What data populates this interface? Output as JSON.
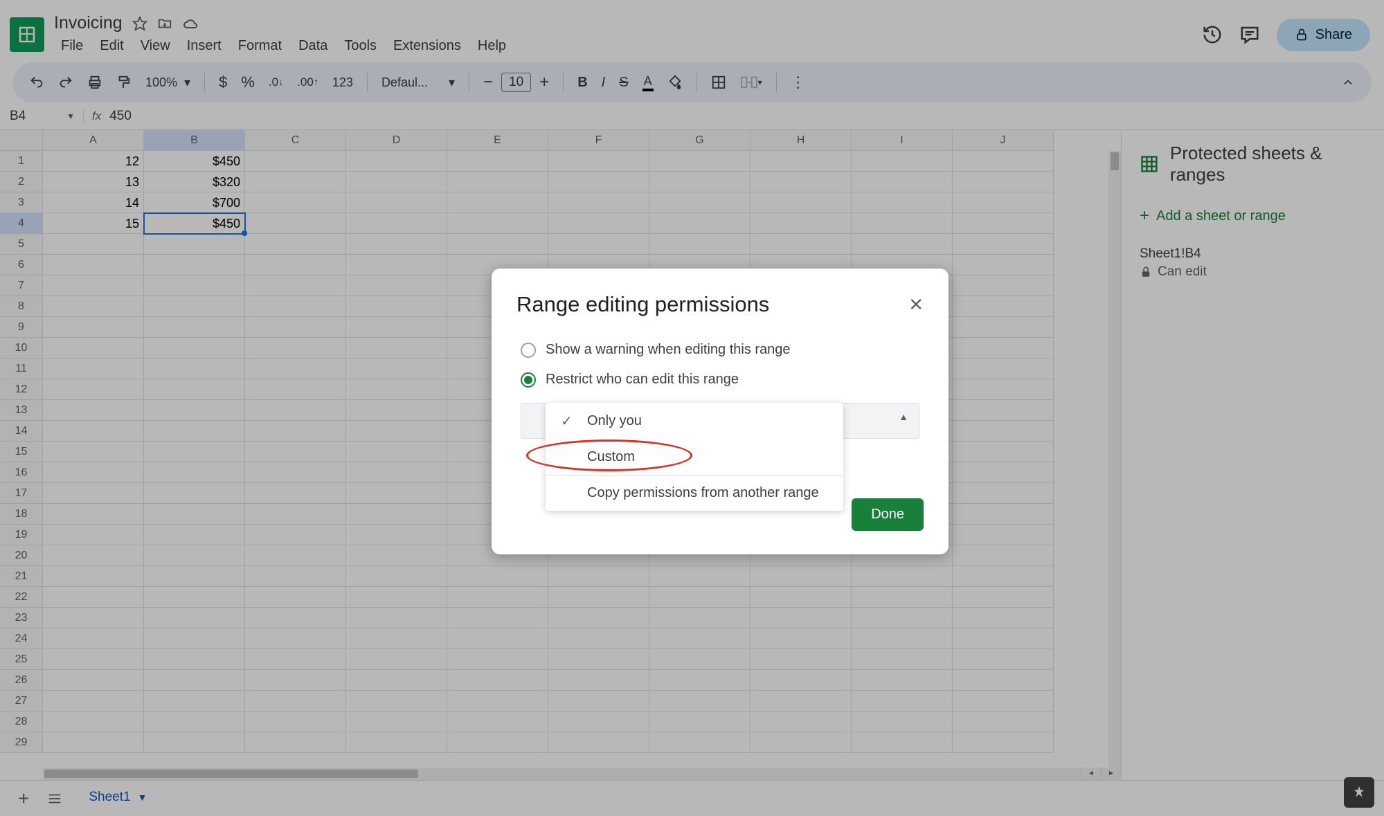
{
  "doc": {
    "title": "Invoicing"
  },
  "menus": [
    "File",
    "Edit",
    "View",
    "Insert",
    "Format",
    "Data",
    "Tools",
    "Extensions",
    "Help"
  ],
  "toolbar": {
    "zoom": "100%",
    "font": "Defaul...",
    "font_size": "10"
  },
  "formula": {
    "cell_ref": "B4",
    "value": "450"
  },
  "columns": [
    "A",
    "B",
    "C",
    "D",
    "E",
    "F",
    "G",
    "H",
    "I",
    "J"
  ],
  "rows": [
    {
      "n": "1",
      "A": "12",
      "B": "$450"
    },
    {
      "n": "2",
      "A": "13",
      "B": "$320"
    },
    {
      "n": "3",
      "A": "14",
      "B": "$700"
    },
    {
      "n": "4",
      "A": "15",
      "B": "$450"
    }
  ],
  "blank_rows": [
    "5",
    "6",
    "7",
    "8",
    "9",
    "10",
    "11",
    "12",
    "13",
    "14",
    "15",
    "16",
    "17",
    "18",
    "19",
    "20",
    "21",
    "22",
    "23",
    "24",
    "25",
    "26",
    "27",
    "28",
    "29"
  ],
  "selected": {
    "col": "B",
    "row": "4"
  },
  "share": "Share",
  "side": {
    "title": "Protected sheets & ranges",
    "add": "Add a sheet or range",
    "range_name": "Sheet1!B4",
    "perm": "Can edit"
  },
  "dialog": {
    "title": "Range editing permissions",
    "opt_warning": "Show a warning when editing this range",
    "opt_restrict": "Restrict who can edit this range",
    "dd_only_you": "Only you",
    "dd_custom": "Custom",
    "dd_copy": "Copy permissions from another range",
    "done": "Done"
  },
  "tab": {
    "name": "Sheet1"
  }
}
